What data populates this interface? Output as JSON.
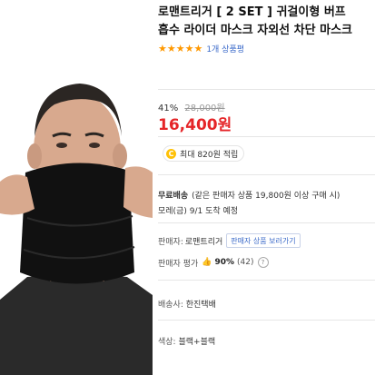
{
  "product": {
    "title_line1": "로맨트리거 [ 2 SET ] 귀걸이형 버프",
    "title_line2": "흡수 라이더 마스크 자외선 차단 마스크",
    "stars": "★★★★★",
    "review_count": "1개 상품평"
  },
  "price": {
    "discount": "41%",
    "original": "28,000원",
    "sale": "16,400원"
  },
  "cashback": {
    "icon": "coin-icon",
    "coin_symbol": "C",
    "text": "최대 820원 적립"
  },
  "shipping": {
    "label": "무료배송",
    "condition": "(같은 판매자 상품 19,800원 이상 구매 시)",
    "arrival": "모레(금) 9/1 도착 예정"
  },
  "seller": {
    "label": "판매자:",
    "name": "로맨트리거",
    "button": "판매자 상품 보러가기"
  },
  "seller_rating": {
    "label": "판매자 평가",
    "thumb_icon": "thumbs-up-icon",
    "thumb": "👍",
    "percent": "90%",
    "count": "(42)",
    "help": "?"
  },
  "carrier": {
    "label": "배송사:",
    "value": "한진택배"
  },
  "option": {
    "label": "색상:",
    "value": "블랙+블랙"
  },
  "colors": {
    "price_red": "#e52528",
    "star_orange": "#ff9800",
    "link_blue": "#3b6ac9",
    "coin_yellow": "#ffc107"
  }
}
